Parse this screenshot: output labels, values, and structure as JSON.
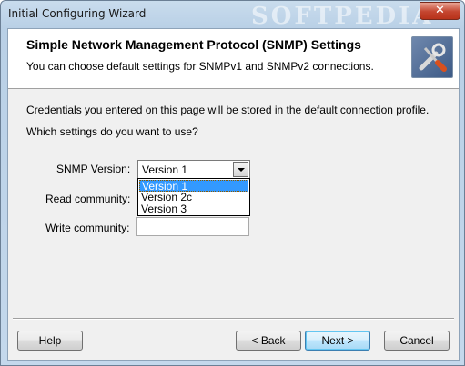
{
  "window": {
    "title": "Initial Configuring Wizard",
    "watermark": "SOFTPEDIA",
    "close_glyph": "✕"
  },
  "header": {
    "title": "Simple Network Management Protocol (SNMP) Settings",
    "subtitle": "You can choose default settings for SNMPv1 and SNMPv2 connections.",
    "icon": "tools-icon"
  },
  "body": {
    "info": "Credentials you entered on this page will be stored in the default connection profile.",
    "question": "Which settings do you want to use?"
  },
  "form": {
    "snmp_version_label": "SNMP Version:",
    "snmp_version_value": "Version 1",
    "snmp_version_options": [
      "Version 1",
      "Version 2c",
      "Version 3"
    ],
    "read_community_label": "Read community:",
    "read_community_value": "",
    "write_community_label": "Write community:",
    "write_community_value": ""
  },
  "footer": {
    "help": "Help",
    "back": "< Back",
    "next": "Next >",
    "cancel": "Cancel"
  }
}
